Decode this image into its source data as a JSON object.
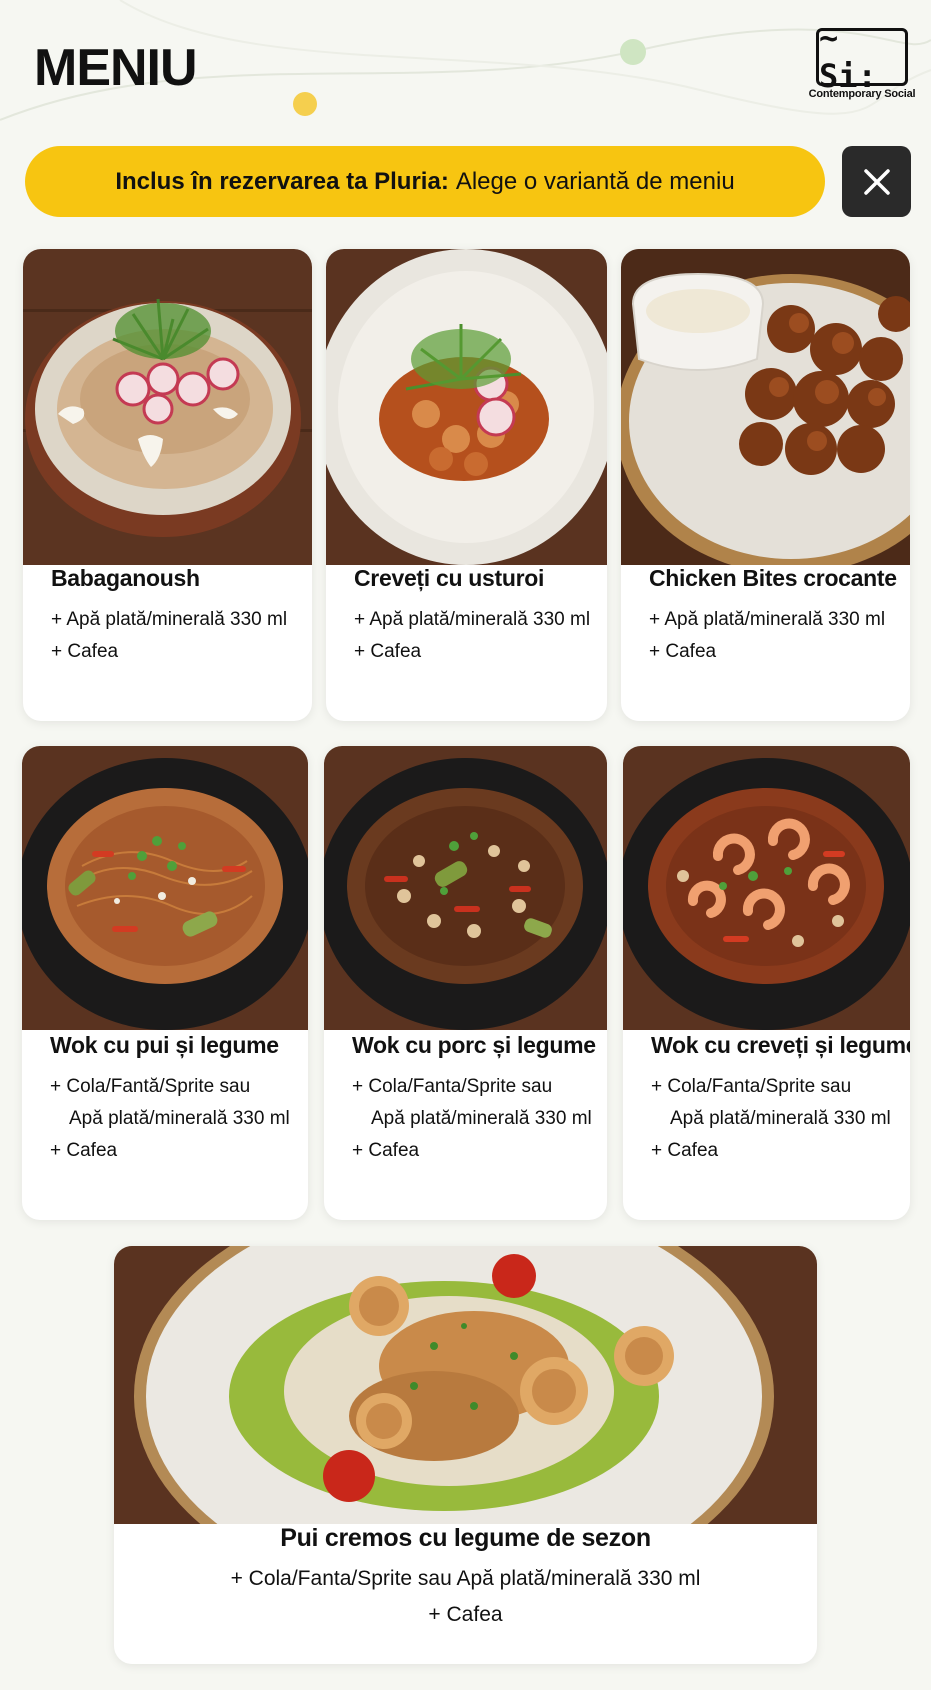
{
  "page": {
    "title": "MENIU",
    "brand": {
      "logo_text": "~ Si:",
      "caption": "Contemporary Social"
    }
  },
  "banner": {
    "bold_text": "Inclus în rezervarea ta Pluria:",
    "text": "Alege o variantă de meniu"
  },
  "close_button": {
    "icon": "close-icon"
  },
  "menu_items": [
    {
      "name": "Babaganoush",
      "lines": [
        "+ Apă plată/minerală 330 ml",
        "+ Cafea"
      ],
      "image": "hummus-plate"
    },
    {
      "name": "Creveți cu usturoi",
      "lines": [
        "+ Apă plată/minerală 330 ml",
        "+ Cafea"
      ],
      "image": "garlic-shrimp-plate"
    },
    {
      "name": "Chicken Bites crocante",
      "lines": [
        "+ Apă plată/minerală 330 ml",
        "+ Cafea"
      ],
      "image": "chicken-bites-plate"
    },
    {
      "name": "Wok cu pui și legume",
      "lines": [
        "+ Cola/Fantă/Sprite sau",
        "Apă plată/minerală 330 ml",
        "+ Cafea"
      ],
      "image": "chicken-wok-bowl"
    },
    {
      "name": "Wok cu porc și legume",
      "lines": [
        "+ Cola/Fanta/Sprite sau",
        "Apă plată/minerală 330 ml",
        "+ Cafea"
      ],
      "image": "pork-wok-bowl"
    },
    {
      "name": "Wok cu creveți și legume",
      "lines": [
        "+ Cola/Fanta/Sprite sau",
        "Apă plată/minerală 330 ml",
        "+ Cafea"
      ],
      "image": "shrimp-wok-bowl"
    },
    {
      "name": "Pui cremos cu legume de sezon",
      "lines": [
        "+ Cola/Fanta/Sprite sau Apă plată/minerală 330 ml",
        "+ Cafea"
      ],
      "image": "creamy-chicken-plate"
    }
  ],
  "colors": {
    "accent": "#f7c511",
    "close_bg": "#2a2a2a",
    "card_bg": "#ffffff",
    "wood": "#5a3320"
  }
}
